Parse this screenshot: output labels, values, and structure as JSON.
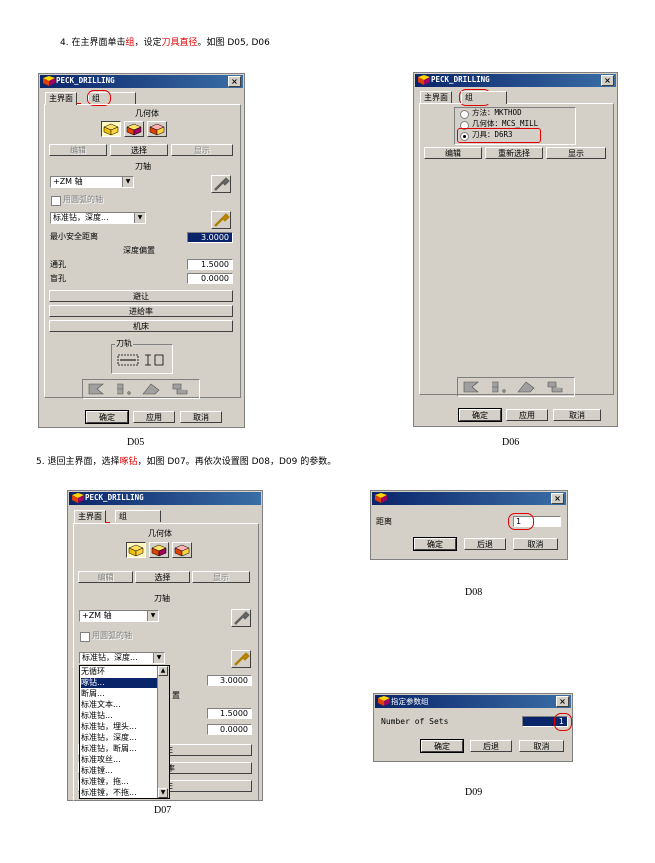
{
  "doc": {
    "step4": {
      "prefix": "4.  在主界面单击",
      "hl1": "组",
      "mid": "，设定",
      "hl2": "刀具直径",
      "suffix": "。如图 D05, D06"
    },
    "step5": {
      "prefix": "5. 退回主界面，选择",
      "hl1": "啄钻",
      "suffix": "，如图 D07。再依次设置图 D08，D09 的参数。"
    },
    "captions": {
      "d05": "D05",
      "d06": "D06",
      "d07": "D07",
      "d08": "D08",
      "d09": "D09"
    }
  },
  "common": {
    "window_title": "PECK_DRILLING",
    "close": "×",
    "tab_main": "主界面",
    "tab_group": "组",
    "geometry_header": "几何体",
    "edit": "编辑",
    "select": "选择",
    "display": "显示",
    "tool_axis_header": "刀轴",
    "tool_axis_value": "+ZM 轴",
    "use_arc_axis": "用圆弧的轴",
    "cycle_value": "标准钻，深度...",
    "min_clearance": "最小安全距离",
    "min_clearance_value": "3.0000",
    "depth_offset": "深度偏置",
    "through_hole": "通孔",
    "through_hole_value": "1.5000",
    "blind_hole": "盲孔",
    "blind_hole_value": "0.0000",
    "avoid": "避让",
    "feedrate": "进给率",
    "machine": "机床",
    "path_group": "刀轨",
    "ok": "确定",
    "apply": "应用",
    "cancel": "取消"
  },
  "d06": {
    "method": "方法：MKTHOD",
    "geometry": "几何体：MCS_MILL",
    "tool": "刀具：D6R3",
    "edit": "编辑",
    "reselect": "重新选择",
    "display": "显示"
  },
  "d07": {
    "cycle_value": "标准钻，深度...",
    "cycle_options": [
      "无循环",
      "啄钻...",
      "断屑...",
      "标准文本...",
      "标准钻...",
      "标准钻，埋头...",
      "标准钻，深度...",
      "标准钻，断屑...",
      "标准攻丝...",
      "标准镗...",
      "标准镗，拖...",
      "标准镗，不拖..."
    ],
    "partial_behind": [
      "置",
      "E",
      "率",
      "E"
    ]
  },
  "d08": {
    "distance": "距离",
    "value": "1",
    "ok": "确定",
    "back": "后退",
    "cancel": "取消"
  },
  "d09": {
    "title": "指定参数组",
    "number_of_sets": "Number of Sets",
    "value": "1",
    "ok": "确定",
    "back": "后退",
    "cancel": "取消"
  }
}
